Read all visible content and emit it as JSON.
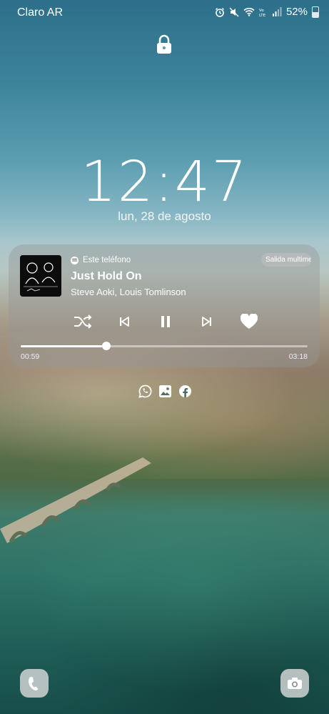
{
  "status_bar": {
    "carrier": "Claro AR",
    "icons": [
      "alarm-icon",
      "mute-icon",
      "wifi-icon",
      "volte-icon",
      "signal-icon"
    ],
    "battery": "52%"
  },
  "lockscreen": {
    "lock_icon": "lock-icon",
    "time_hour": "12",
    "time_min": "47",
    "date": "lun, 28 de agosto"
  },
  "media": {
    "source_app_icon": "spotify-icon",
    "source": "Este teléfono",
    "output_button": "Salida multime...",
    "title": "Just Hold On",
    "artist": "Steve Aoki, Louis Tomlinson",
    "controls": [
      "shuffle-icon",
      "previous-icon",
      "pause-icon",
      "next-icon",
      "heart-icon"
    ],
    "elapsed": "00:59",
    "duration": "03:18",
    "progress": 0.298
  },
  "notifications": [
    "whatsapp-icon",
    "gallery-icon",
    "facebook-icon"
  ],
  "shortcuts": {
    "left": "phone-icon",
    "right": "camera-icon"
  }
}
